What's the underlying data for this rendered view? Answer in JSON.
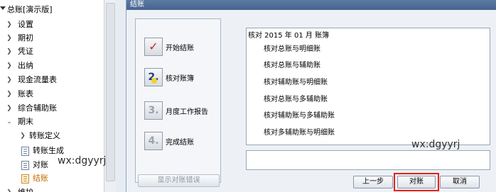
{
  "sidebar": {
    "root_label": "总账[演示版]",
    "items": [
      {
        "label": "设置"
      },
      {
        "label": "期初"
      },
      {
        "label": "凭证"
      },
      {
        "label": "出纳"
      },
      {
        "label": "现金流量表"
      },
      {
        "label": "账表"
      },
      {
        "label": "综合辅助账"
      },
      {
        "label": "期末"
      }
    ],
    "children": [
      {
        "label": "转账定义"
      },
      {
        "label": "转账生成"
      },
      {
        "label": "对账"
      },
      {
        "label": "结账"
      }
    ],
    "last_partial_label": "维护"
  },
  "dialog": {
    "title": "结账",
    "steps": [
      {
        "num": "✓",
        "label": "开始结账"
      },
      {
        "num": "2.",
        "label": "核对账簿"
      },
      {
        "num": "3.",
        "label": "月度工作报告"
      },
      {
        "num": "4.",
        "label": "完成结账"
      }
    ],
    "results_heading": "核对 2015 年 01 月 账簿",
    "results_items": [
      "核对总账与明细账",
      "核对总账与辅助账",
      "核对辅助账与明细账",
      "核对总账与多辅助账",
      "核对辅助账与多辅助账",
      "核对多辅助账与明细账"
    ],
    "buttons": {
      "show_errors": "显示对账错误",
      "prev": "上一步",
      "verify": "对账",
      "cancel": "取消"
    }
  },
  "watermarks": {
    "right": "wx:dgyyrj",
    "left": "wx:dgyyrj"
  },
  "colors": {
    "titlebar": "#46648f",
    "highlight": "#e2231a",
    "active_item": "#c88a2c"
  }
}
